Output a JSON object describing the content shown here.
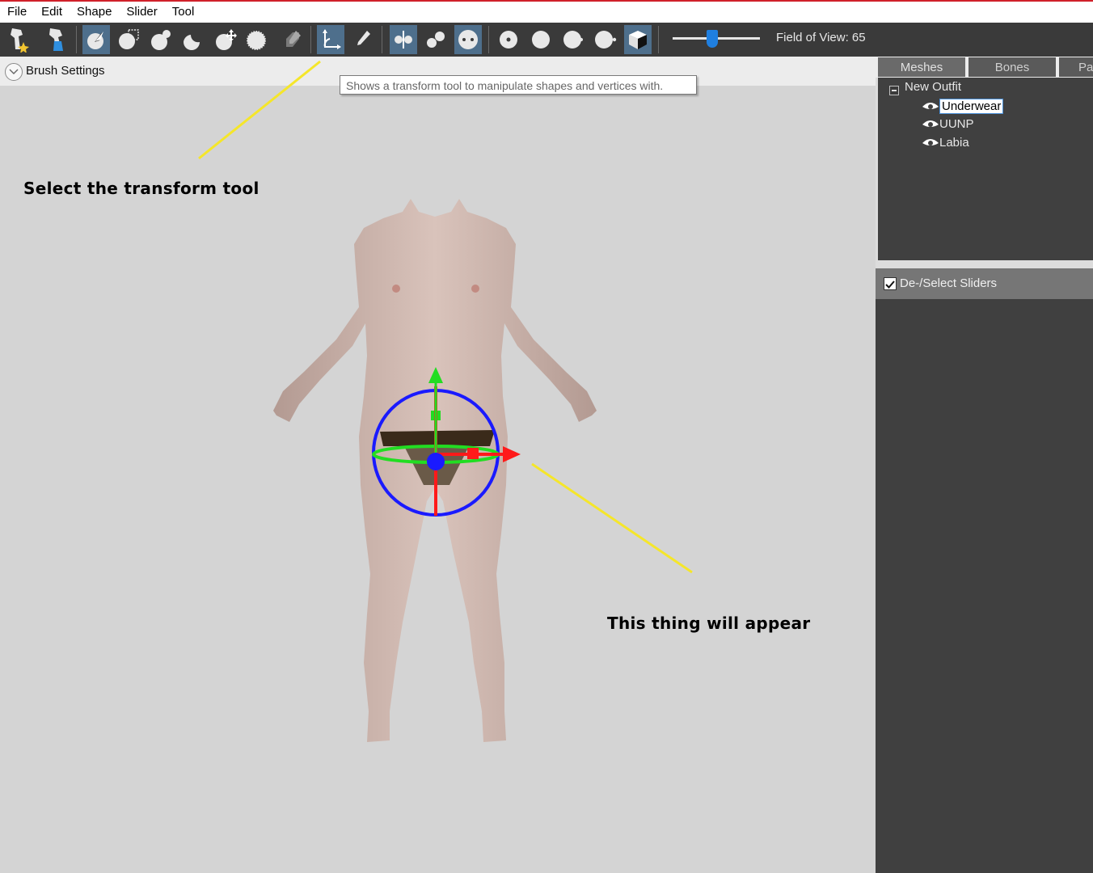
{
  "menu": [
    "File",
    "Edit",
    "Shape",
    "Slider",
    "Tool"
  ],
  "toolbar": {
    "buttons": [
      {
        "name": "load-reference-icon"
      },
      {
        "name": "load-outfit-icon"
      },
      {
        "name": "select-brush-icon"
      },
      {
        "name": "mask-brush-icon"
      },
      {
        "name": "inflate-brush-icon"
      },
      {
        "name": "deflate-brush-icon"
      },
      {
        "name": "move-brush-icon"
      },
      {
        "name": "smooth-brush-icon"
      },
      {
        "name": "weight-brush-icon"
      },
      {
        "name": "transform-tool-icon"
      },
      {
        "name": "pivot-tool-icon"
      },
      {
        "name": "x-mirror-icon"
      },
      {
        "name": "connected-only-icon"
      },
      {
        "name": "global-brush-icon"
      },
      {
        "name": "vertex-dot-icon"
      },
      {
        "name": "wireframe-icon"
      },
      {
        "name": "lighting-icon"
      },
      {
        "name": "texture-icon"
      },
      {
        "name": "cube-view-icon"
      }
    ],
    "fov_label": "Field of View: 65",
    "fov_value": 65
  },
  "brush_settings": {
    "label": "Brush Settings"
  },
  "tooltip": {
    "text": "Shows a transform tool to manipulate shapes and vertices with."
  },
  "annotations": {
    "select_transform": "Select the transform tool",
    "thing_appear": "This thing will appear",
    "line_color": "#f5e62a"
  },
  "panel": {
    "tabs": [
      "Meshes",
      "Bones",
      "Pa"
    ],
    "tree_root": "New Outfit",
    "meshes": [
      "Underwear",
      "UUNP",
      "Labia"
    ],
    "sliders_label": "De-/Select Sliders"
  },
  "colors": {
    "toolbar_bg": "#3a3a3a",
    "active_button": "#4e6f8c",
    "panel_dark": "#404040",
    "viewport_bg": "#d4d4d4",
    "gizmo_x": "#ff1a1a",
    "gizmo_y": "#22dd22",
    "gizmo_z": "#1a1aff"
  }
}
